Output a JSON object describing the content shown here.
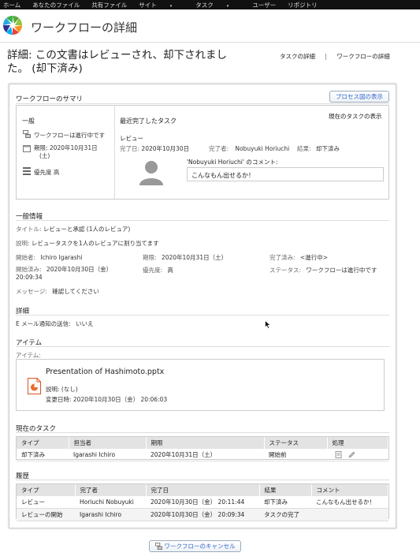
{
  "topnav": {
    "items": [
      "ホーム",
      "あなたのファイル",
      "共有ファイル",
      "サイト",
      "タスク",
      "ユーザー",
      "リポジトリ"
    ],
    "dropdown_indicator": "▾"
  },
  "header": {
    "title": "ワークフローの詳細"
  },
  "page": {
    "heading_line1": "詳細: この文書はレビューされ、却下されまし",
    "heading_line2": "た。 (却下済み)",
    "links": {
      "task_details": "タスクの詳細",
      "separator": "|",
      "workflow_details": "ワークフローの詳細"
    }
  },
  "summary": {
    "title": "ワークフローのサマリ",
    "process_diagram_button": "プロセス図の表示",
    "current_task_link": "現在のタスクの表示",
    "general": {
      "title": "一般",
      "status": "ワークフローは進行中です",
      "due_label": "期限: 2020年10月31日",
      "due_weekday": "(土)",
      "priority": "優先度 高"
    },
    "recent_task": {
      "title": "最近完了したタスク",
      "name": "レビュー",
      "completed_label": "完了日:",
      "completed_value": "2020年10月30日",
      "completer_label": "完了者:",
      "completer_value": "Nobuyuki Horiuchi",
      "result_label": "結果:",
      "result_value": "却下済み",
      "comment_label": "'Nobuyuki Horiuchi' のコメント:",
      "comment_value": "こんなもん出せるか！"
    }
  },
  "general_info": {
    "title": "一般情報",
    "title_label": "タイトル:",
    "title_value": "レビューと承認 (1人のレビュア)",
    "description_label": "説明:",
    "description_value": "レビュータスクを1人のレビュアに割り当てます",
    "initiator_label": "開始者:",
    "initiator_value": "Ichiro Igarashi",
    "due_label": "期限:",
    "due_value": "2020年10月31日（土）",
    "completed_label": "完了済み:",
    "completed_value": "<進行中>",
    "started_label": "開始済み:",
    "started_value": "2020年10月30日（金）",
    "started_time": "20:09:34",
    "priority_label": "優先度:",
    "priority_value": "高",
    "status_label": "ステータス:",
    "status_value": "ワークフローは進行中です",
    "message_label": "メッセージ:",
    "message_value": "確認してください"
  },
  "details": {
    "title": "詳細",
    "email_label": "E メール通知の送信:",
    "email_value": "いいえ"
  },
  "items": {
    "title": "アイテム",
    "label": "アイテム:",
    "file_name": "Presentation of Hashimoto.pptx",
    "description": "説明: (なし)",
    "modified": "変更日時: 2020年10月30日（金） 20:06:03"
  },
  "current_tasks": {
    "title": "現在のタスク",
    "headers": [
      "タイプ",
      "担当者",
      "期限",
      "ステータス",
      "処理"
    ],
    "rows": [
      {
        "type": "却下済み",
        "assignee": "Igarashi Ichiro",
        "due": "2020年10月31日（土）",
        "status": "開始前"
      }
    ]
  },
  "history": {
    "title": "履歴",
    "headers": [
      "タイプ",
      "完了者",
      "完了日",
      "結果",
      "コメント"
    ],
    "rows": [
      {
        "type": "レビュー",
        "completer": "Horiuchi Nobuyuki",
        "date": "2020年10月30日（金） 20:11:44",
        "result": "却下済み",
        "comment": "こんなもん出せるか！"
      },
      {
        "type": "レビューの開始",
        "completer": "Igarashi Ichiro",
        "date": "2020年10月30日（金） 20:09:34",
        "result": "タスクの完了",
        "comment": ""
      }
    ]
  },
  "cancel_button": "ワークフローのキャンセル"
}
